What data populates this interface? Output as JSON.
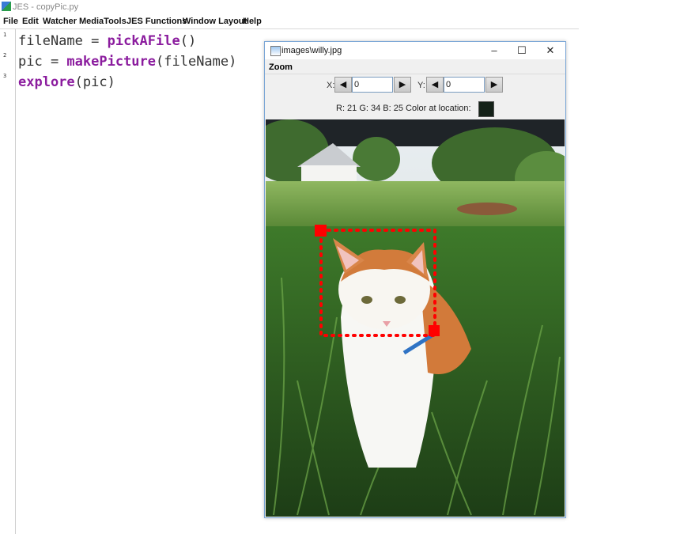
{
  "app": {
    "window_title": "JES - copyPic.py",
    "menu": [
      "File",
      "Edit",
      "Watcher",
      "MediaTools",
      "JES Functions",
      "Window Layout",
      "Help"
    ]
  },
  "editor": {
    "line_numbers": [
      "1",
      "2",
      "3"
    ],
    "lines": [
      {
        "pre": "fileName = ",
        "kw": "pickAFile",
        "post": "()"
      },
      {
        "pre": "pic = ",
        "kw": "makePicture",
        "post": "(fileName)"
      },
      {
        "pre": "",
        "kw": "explore",
        "post": "(pic)"
      }
    ]
  },
  "explorer": {
    "title": "images\\willy.jpg",
    "controls": {
      "minimize": "–",
      "maximize": "☐",
      "close": "✕"
    },
    "menu_zoom": "Zoom",
    "x_label": "X:",
    "y_label": "Y:",
    "x_value": "0",
    "y_value": "0",
    "left_arrow": "◀",
    "right_arrow": "▶",
    "color_info": "R: 21  G: 34  B: 25  Color at location:",
    "swatch_color": "#152219"
  },
  "colors": {
    "keyword": "#8b1c9e",
    "selection_marker": "#ff0000"
  }
}
